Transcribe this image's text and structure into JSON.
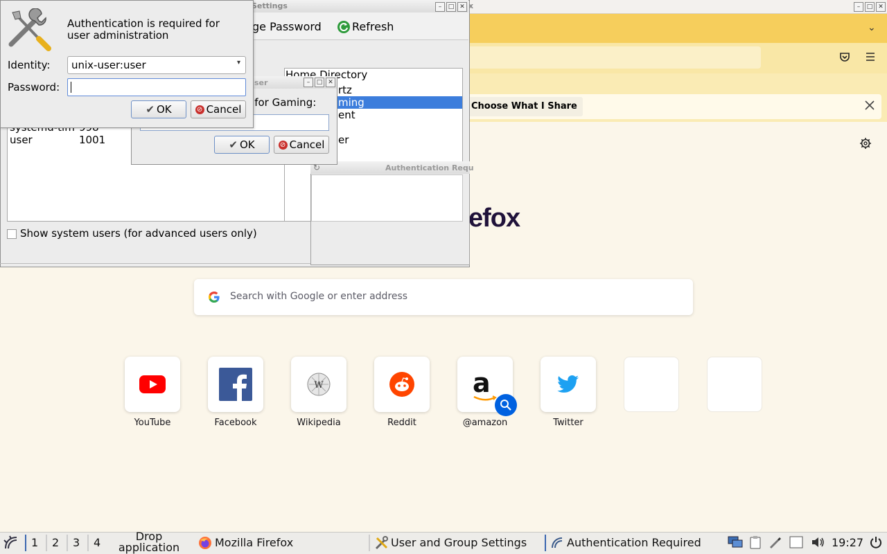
{
  "firefox": {
    "window_title": "x",
    "choose_label": "Choose What I Share",
    "logo_text": "efox",
    "search_placeholder": "Search with Google or enter address",
    "shortcuts": [
      {
        "label": "YouTube",
        "icon": "youtube-icon"
      },
      {
        "label": "Facebook",
        "icon": "facebook-icon"
      },
      {
        "label": "Wikipedia",
        "icon": "wikipedia-icon"
      },
      {
        "label": "Reddit",
        "icon": "reddit-icon"
      },
      {
        "label": "@amazon",
        "icon": "amazon-icon"
      },
      {
        "label": "Twitter",
        "icon": "twitter-icon"
      },
      {
        "label": ""
      },
      {
        "label": ""
      }
    ]
  },
  "user_settings": {
    "title": "Settings",
    "change_password_label": "ge Password",
    "refresh_label": "Refresh",
    "column_home": "Home Directory",
    "rows_right": [
      "rtz",
      "ming",
      "ent",
      "er"
    ],
    "users": [
      {
        "name": "systemd-tim",
        "id": "998"
      },
      {
        "name": "user",
        "id": "1001"
      }
    ],
    "show_system_users": "Show system users (for advanced users only)"
  },
  "auth_small": {
    "title": "Authentication Requ"
  },
  "gaming_dialog": {
    "title": "ser",
    "prompt": "rd for Gaming:",
    "ok_label": "OK",
    "cancel_label": "Cancel"
  },
  "auth_dialog": {
    "message": "Authentication is required for user administration",
    "identity_label": "Identity:",
    "identity_value": "unix-user:user",
    "password_label": "Password:",
    "password_value": "",
    "ok_label": "OK",
    "cancel_label": "Cancel"
  },
  "taskbar": {
    "workspaces": [
      "1",
      "2",
      "3",
      "4"
    ],
    "drop_text": "Drop application icons here",
    "tasks": [
      {
        "label": "Mozilla Firefox",
        "icon": "firefox-icon"
      },
      {
        "label": "User and Group Settings",
        "icon": "tools-icon"
      },
      {
        "label": "Authentication Required",
        "icon": "auth-icon"
      }
    ],
    "clock": "19:27"
  },
  "colors": {
    "tabbar": "#f6ce5c",
    "selection": "#3c7ddc",
    "page_bg": "#fbf6ea"
  }
}
